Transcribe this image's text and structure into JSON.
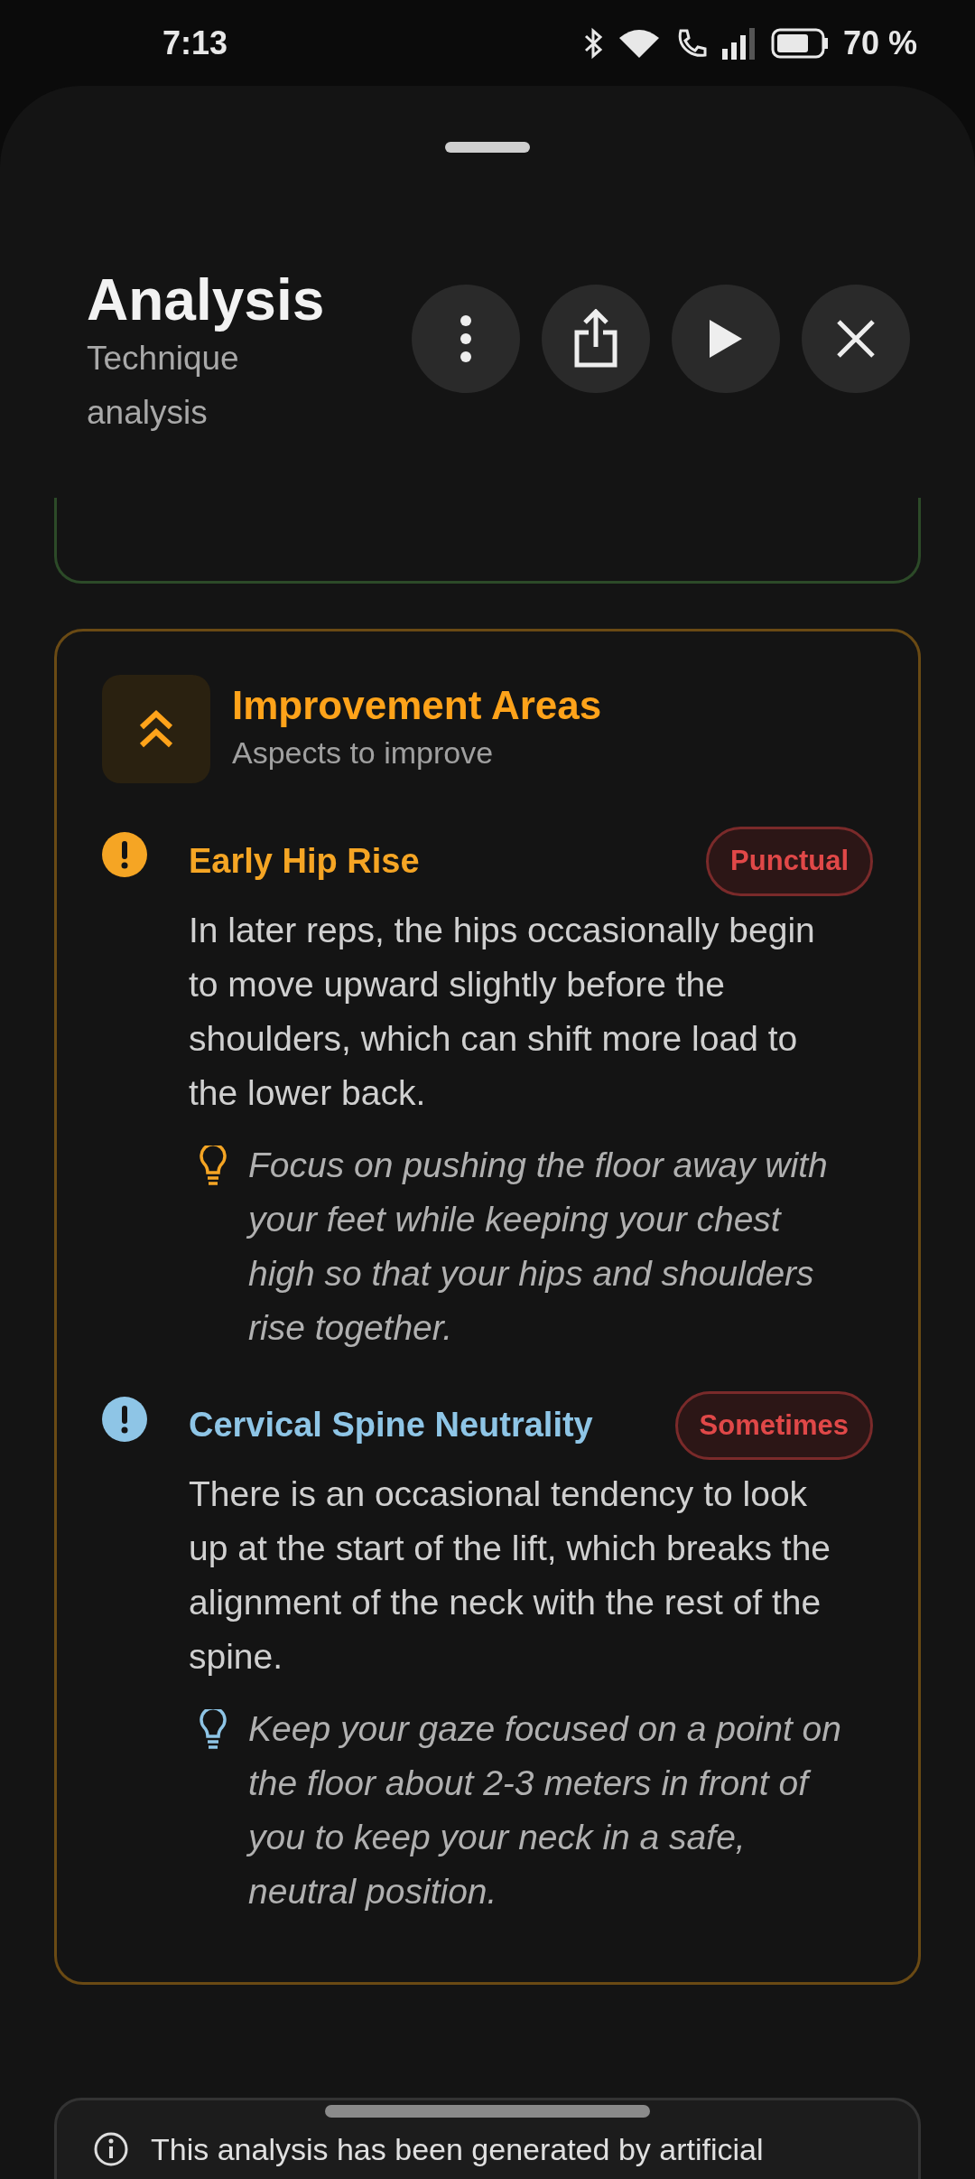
{
  "status_bar": {
    "time": "7:13",
    "battery": "70 %"
  },
  "header": {
    "title": "Analysis",
    "subtitle": "Technique analysis",
    "actions": [
      {
        "kind": "more"
      },
      {
        "kind": "share"
      },
      {
        "kind": "play"
      },
      {
        "kind": "close"
      }
    ]
  },
  "section": {
    "title": "Improvement Areas",
    "subtitle": "Aspects to improve",
    "items": [
      {
        "title": "Early Hip Rise",
        "color": "#f5a524",
        "badge": "Punctual",
        "description": "In later reps, the hips occasionally begin to move upward slightly before the shoulders, which can shift more load to the lower back.",
        "tip": "Focus on pushing the floor away with your feet while keeping your chest high so that your hips and shoulders rise together."
      },
      {
        "title": "Cervical Spine Neutrality",
        "color": "#8ec5e6",
        "badge": "Sometimes",
        "description": "There is an occasional tendency to look up at the start of the lift, which breaks the alignment of the neck with the rest of the spine.",
        "tip": "Keep your gaze focused on a point on the floor about 2-3 meters in front of you to keep your neck in a safe, neutral position."
      }
    ]
  },
  "disclaimer": {
    "text": "This analysis has been generated by artificial"
  }
}
